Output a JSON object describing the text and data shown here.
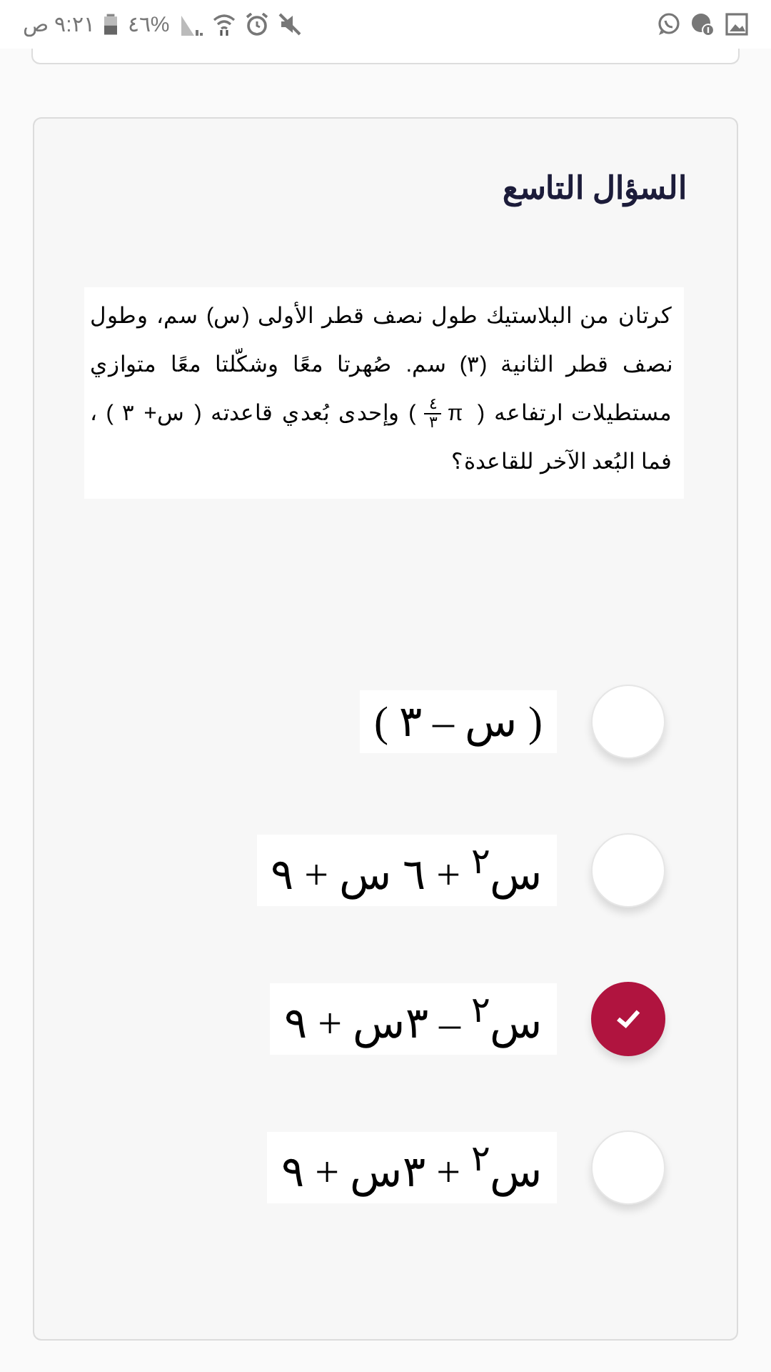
{
  "status_bar": {
    "time": "٩:٢١ ص",
    "battery_text": "%٤٦"
  },
  "question": {
    "title": "السؤال التاسع",
    "lines": [
      "كرتان من البلاستيك طول نصف قطر الأولى (س) سم، وطول نصف قطر الثانية (٣) سم. صُهرتا معًا وشكّلتا معًا متوازي مستطيلات ارتفاعه (",
      ") وإحدى بُعدي قاعدته ( س+ ٣ ) ، فما البُعد الآخر للقاعدة؟"
    ],
    "fraction": {
      "numerator": "٤",
      "denominator": "٣",
      "symbol": "π"
    }
  },
  "options": [
    {
      "text": "( س – ٣ )",
      "selected": false
    },
    {
      "text": "س$^{٢}$ + ٦ س + ٩",
      "selected": false
    },
    {
      "text": "س$^{٢}$ – ٣س + ٩",
      "selected": true
    },
    {
      "text": "س$^{٢}$ + ٣س + ٩",
      "selected": false
    }
  ]
}
